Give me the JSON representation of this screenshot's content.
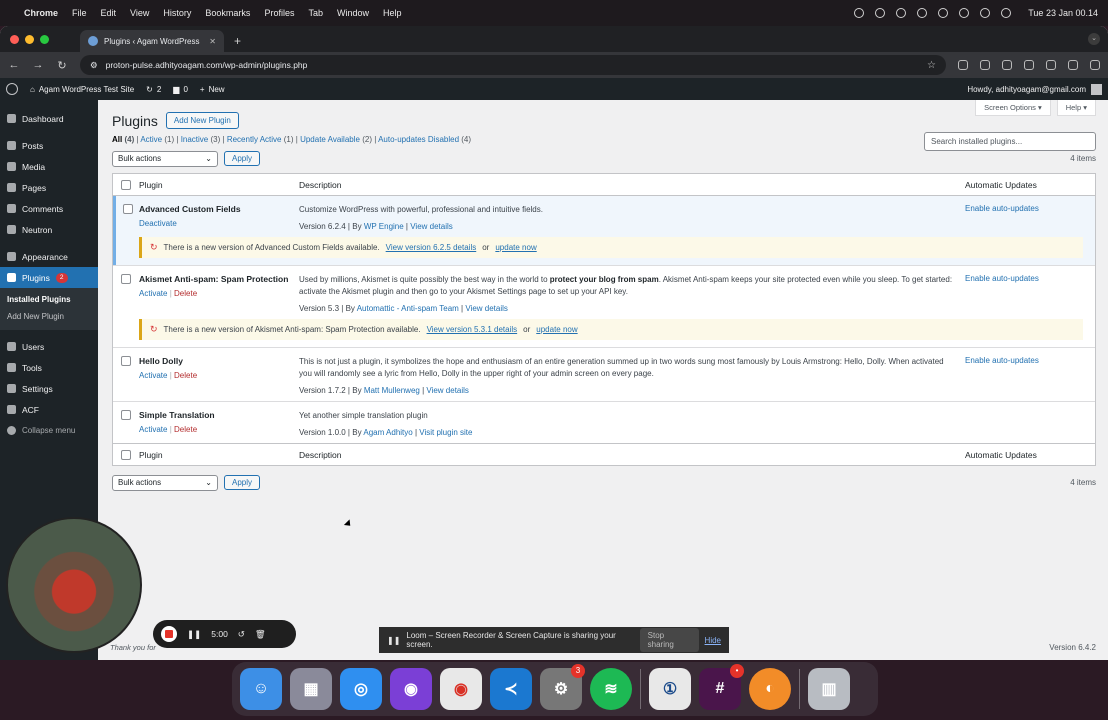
{
  "menubar": {
    "app": "Chrome",
    "items": [
      "File",
      "Edit",
      "View",
      "History",
      "Bookmarks",
      "Profiles",
      "Tab",
      "Window",
      "Help"
    ],
    "clock": "Tue 23 Jan  00.14"
  },
  "browser": {
    "tab_title": "Plugins ‹ Agam WordPress",
    "url": "proton-pulse.adhityoagam.com/wp-admin/plugins.php"
  },
  "adminbar": {
    "site_name": "Agam WordPress Test Site",
    "updates_count": "2",
    "comments_count": "0",
    "new_label": "New",
    "howdy": "Howdy, adhityoagam@gmail.com"
  },
  "sidebar": {
    "items": [
      {
        "label": "Dashboard"
      },
      {
        "label": "Posts"
      },
      {
        "label": "Media"
      },
      {
        "label": "Pages"
      },
      {
        "label": "Comments"
      },
      {
        "label": "Neutron"
      },
      {
        "label": "Appearance"
      },
      {
        "label": "Plugins",
        "count": "2"
      },
      {
        "label": "Users"
      },
      {
        "label": "Tools"
      },
      {
        "label": "Settings"
      },
      {
        "label": "ACF"
      }
    ],
    "submenu": [
      "Installed Plugins",
      "Add New Plugin"
    ],
    "collapse": "Collapse menu"
  },
  "screen_meta": {
    "options": "Screen Options ▾",
    "help": "Help ▾"
  },
  "page": {
    "title": "Plugins",
    "add_new": "Add New Plugin",
    "filters": [
      {
        "label": "All",
        "count": "(4)"
      },
      {
        "label": "Active",
        "count": "(1)"
      },
      {
        "label": "Inactive",
        "count": "(3)"
      },
      {
        "label": "Recently Active",
        "count": "(1)"
      },
      {
        "label": "Update Available",
        "count": "(2)"
      },
      {
        "label": "Auto-updates Disabled",
        "count": "(4)"
      }
    ],
    "search_placeholder": "Search installed plugins...",
    "bulk_actions": "Bulk actions",
    "apply": "Apply",
    "items_count": "4 items",
    "columns": {
      "plugin": "Plugin",
      "description": "Description",
      "auto": "Automatic Updates"
    },
    "plugins": [
      {
        "name": "Advanced Custom Fields",
        "action1": "Deactivate",
        "description": "Customize WordPress with powerful, professional and intuitive fields.",
        "version": "Version 6.2.4",
        "by": "By",
        "author": "WP Engine",
        "link": "View details",
        "auto": "Enable auto-updates",
        "update": {
          "text": "There is a new version of Advanced Custom Fields available.",
          "link": "View version 6.2.5 details",
          "or": "or",
          "now": "update now"
        }
      },
      {
        "name": "Akismet Anti-spam: Spam Protection",
        "action1": "Activate",
        "action2": "Delete",
        "description_pre": "Used by millions, Akismet is quite possibly the best way in the world to",
        "description_bold": "protect your blog from spam",
        "description_post": ". Akismet Anti-spam keeps your site protected even while you sleep. To get started: activate the Akismet plugin and then go to your Akismet Settings page to set up your API key.",
        "version": "Version 5.3",
        "by": "By",
        "author": "Automattic - Anti-spam Team",
        "link": "View details",
        "auto": "Enable auto-updates",
        "update": {
          "text": "There is a new version of Akismet Anti-spam: Spam Protection available.",
          "link": "View version 5.3.1 details",
          "or": "or",
          "now": "update now"
        }
      },
      {
        "name": "Hello Dolly",
        "action1": "Activate",
        "action2": "Delete",
        "description": "This is not just a plugin, it symbolizes the hope and enthusiasm of an entire generation summed up in two words sung most famously by Louis Armstrong: Hello, Dolly. When activated you will randomly see a lyric from Hello, Dolly in the upper right of your admin screen on every page.",
        "version": "Version 1.7.2",
        "by": "By",
        "author": "Matt Mullenweg",
        "link": "View details",
        "auto": "Enable auto-updates"
      },
      {
        "name": "Simple Translation",
        "action1": "Activate",
        "action2": "Delete",
        "description": "Yet another simple translation plugin",
        "version": "Version 1.0.0",
        "by": "By",
        "author": "Agam Adhityo",
        "link": "Visit plugin site"
      }
    ],
    "footer_version": "Version 6.4.2",
    "footer_thanks": "Thank you for"
  },
  "recorder": {
    "time": "5:00"
  },
  "loom_bar": {
    "text": "Loom – Screen Recorder & Screen Capture is sharing your screen.",
    "stop": "Stop sharing",
    "hide": "Hide"
  },
  "dock": {
    "settings_badge": "3",
    "slack_badge": "•"
  }
}
